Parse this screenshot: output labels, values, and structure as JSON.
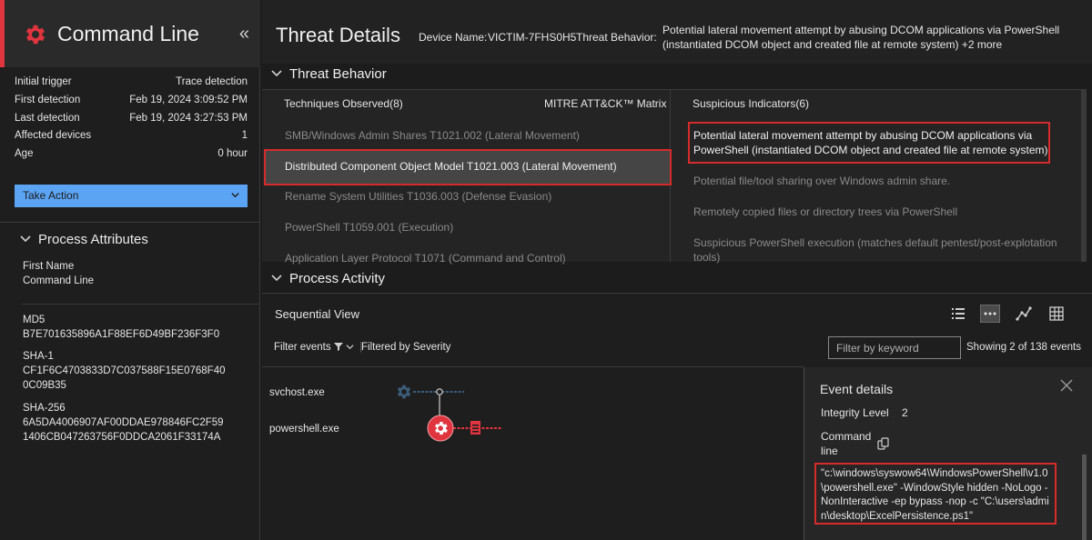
{
  "left_panel": {
    "title": "Command Line",
    "summary": [
      {
        "label": "Initial trigger",
        "value": "Trace detection"
      },
      {
        "label": "First detection",
        "value": "Feb 19, 2024 3:09:52 PM"
      },
      {
        "label": "Last detection",
        "value": "Feb 19, 2024 3:27:53 PM"
      },
      {
        "label": "Affected devices",
        "value": "1"
      },
      {
        "label": "Age",
        "value": "0 hour"
      }
    ],
    "take_action": "Take Action",
    "process_attributes": {
      "heading": "Process Attributes",
      "first_name_label": "First Name",
      "first_name_value": "Command Line",
      "md5_label": "MD5",
      "md5_value": "B7E701635896A1F88EF6D49BF236F3F0",
      "sha1_label": "SHA-1",
      "sha1_value": "CF1F6C4703833D7C037588F15E0768F40 0C09B35",
      "sha256_label": "SHA-256",
      "sha256_value": "6A5DA4006907AF00DDAE978846FC2F59 1406CB047263756F0DDCA2061F33174A"
    }
  },
  "header": {
    "title": "Threat Details",
    "device_label": "Device Name:",
    "device_value": "VICTIM-7FHS0H5",
    "behavior_label": "Threat Behavior:",
    "behavior_value": "Potential lateral movement attempt by abusing DCOM applications via PowerShell (instantiated DCOM object and created file at remote system) +2 more"
  },
  "threat_behavior": {
    "heading": "Threat Behavior",
    "techniques_tab": "Techniques Observed(8)",
    "mitre_tab": "MITRE ATT&CK™ Matrix",
    "suspicious_tab": "Suspicious Indicators(6)",
    "techniques": [
      "SMB/Windows Admin Shares T1021.002 (Lateral Movement)",
      "Distributed Component Object Model T1021.003 (Lateral Movement)",
      "Rename System Utilities T1036.003 (Defense Evasion)",
      "PowerShell T1059.001 (Execution)",
      "Application Layer Protocol T1071 (Command and Control)"
    ],
    "indicators": [
      "Potential lateral movement attempt by abusing DCOM applications via PowerShell (instantiated DCOM object and created file at remote system)",
      "Potential file/tool sharing over Windows admin share.",
      "Remotely copied files or directory trees via PowerShell",
      "Suspicious PowerShell execution (matches default pentest/post-explotation tools)"
    ]
  },
  "process_activity": {
    "heading": "Process Activity",
    "view_title": "Sequential View",
    "filter_events": "Filter events",
    "filtered_by": "Filtered by Severity",
    "keyword_placeholder": "Filter by keyword",
    "showing": "Showing 2 of 138 events",
    "processes": [
      "svchost.exe",
      "powershell.exe"
    ],
    "colors": {
      "accent_red": "#e0343f",
      "node_blue": "#3c5d7a",
      "highlight_red": "#d62b2b",
      "take_action_blue": "#5ba4f3"
    }
  },
  "event_details": {
    "title": "Event details",
    "integrity_label": "Integrity Level",
    "integrity_value": "2",
    "command_label": "Command line",
    "command_value": "\"c:\\windows\\syswow64\\WindowsPowerShell\\v1.0\\powershell.exe\" -WindowStyle hidden -NoLogo -NonInteractive -ep bypass -nop -c \"C:\\users\\admin\\desktop\\ExcelPersistence.ps1\""
  }
}
